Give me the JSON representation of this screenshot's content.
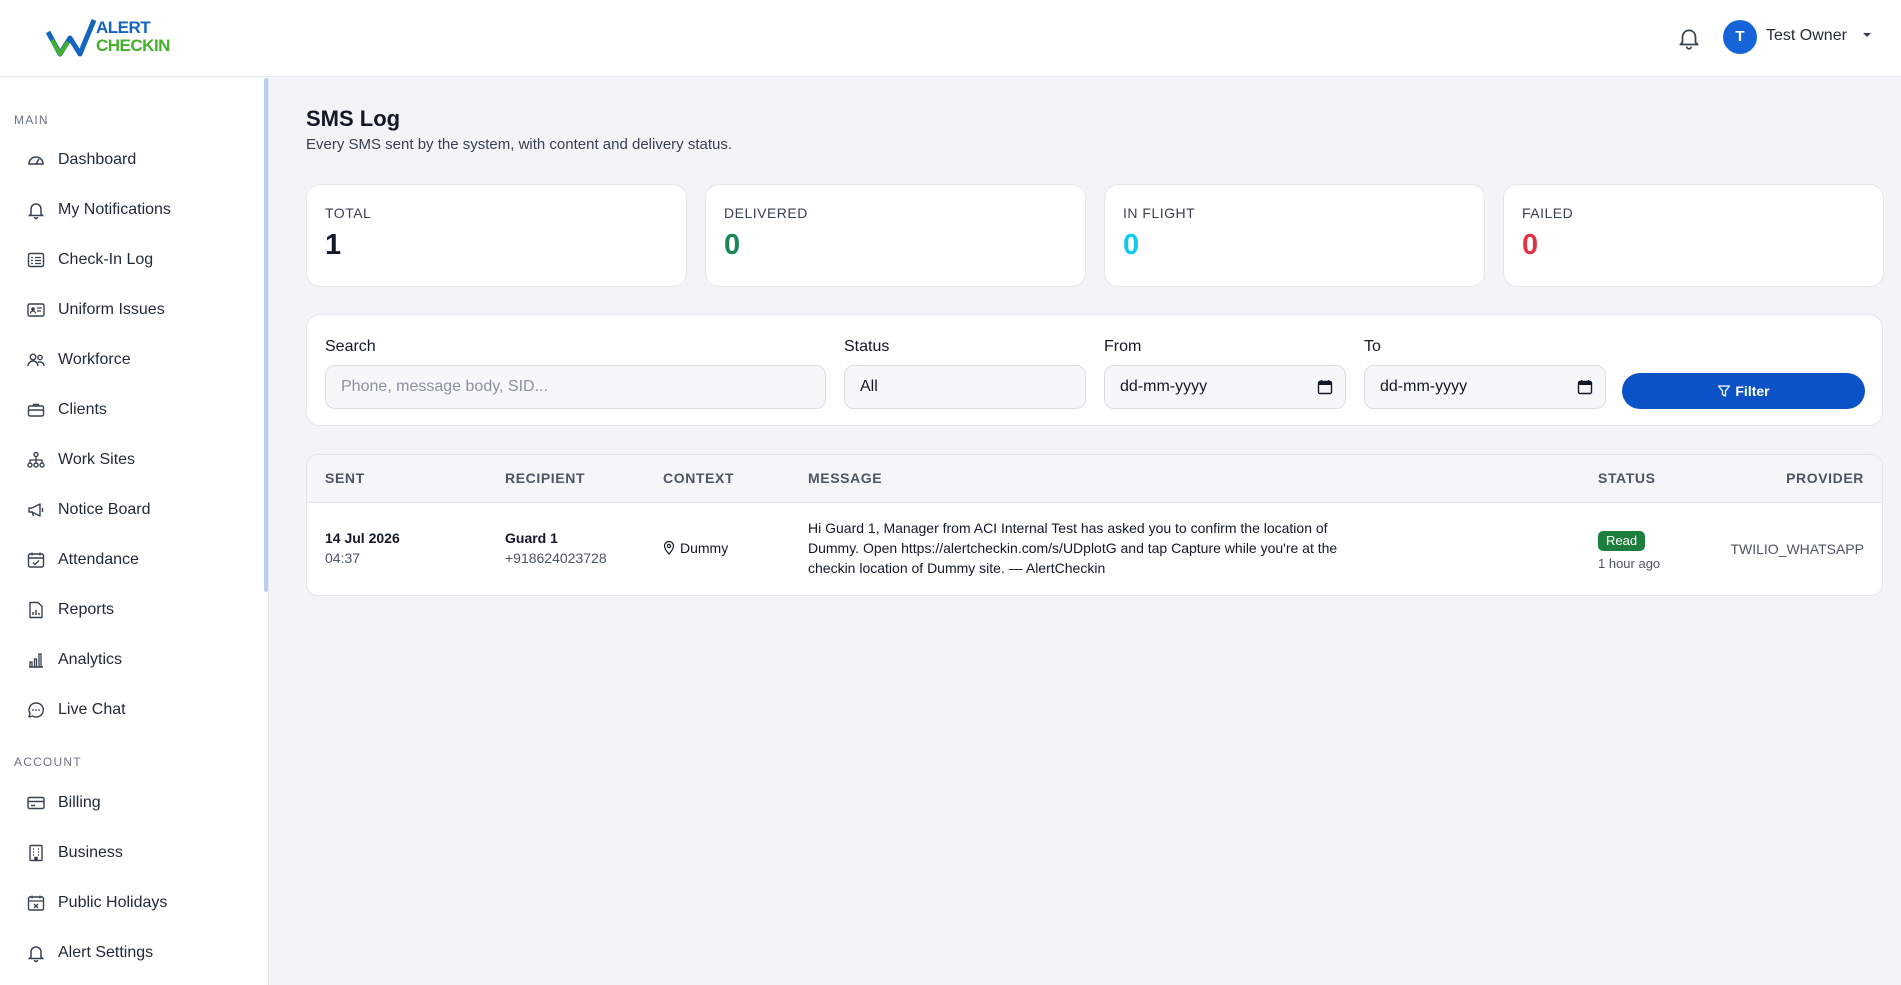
{
  "app": {
    "logo_line1": "ALERT",
    "logo_line2": "CHECKIN",
    "user_initial": "T",
    "user_name": "Test Owner"
  },
  "sidebar": {
    "main_label": "MAIN",
    "main_items": [
      {
        "label": "Dashboard",
        "icon": "dashboard-icon"
      },
      {
        "label": "My Notifications",
        "icon": "bell-icon"
      },
      {
        "label": "Check-In Log",
        "icon": "list-icon"
      },
      {
        "label": "Uniform Issues",
        "icon": "id-card-icon"
      },
      {
        "label": "Workforce",
        "icon": "people-icon"
      },
      {
        "label": "Clients",
        "icon": "briefcase-icon"
      },
      {
        "label": "Work Sites",
        "icon": "sitemap-icon"
      },
      {
        "label": "Notice Board",
        "icon": "megaphone-icon"
      },
      {
        "label": "Attendance",
        "icon": "calendar-check-icon"
      },
      {
        "label": "Reports",
        "icon": "report-icon"
      },
      {
        "label": "Analytics",
        "icon": "bar-chart-icon"
      },
      {
        "label": "Live Chat",
        "icon": "chat-icon"
      }
    ],
    "account_label": "ACCOUNT",
    "account_items": [
      {
        "label": "Billing",
        "icon": "credit-card-icon"
      },
      {
        "label": "Business",
        "icon": "building-icon"
      },
      {
        "label": "Public Holidays",
        "icon": "calendar-x-icon"
      },
      {
        "label": "Alert Settings",
        "icon": "bell-icon"
      }
    ]
  },
  "page": {
    "title": "SMS Log",
    "subtitle": "Every SMS sent by the system, with content and delivery status."
  },
  "stats": [
    {
      "label": "TOTAL",
      "value": "1",
      "color": "#111827"
    },
    {
      "label": "DELIVERED",
      "value": "0",
      "color": "#198754"
    },
    {
      "label": "IN FLIGHT",
      "value": "0",
      "color": "#0dcaf0"
    },
    {
      "label": "FAILED",
      "value": "0",
      "color": "#dc3545"
    }
  ],
  "filters": {
    "search_label": "Search",
    "search_placeholder": "Phone, message body, SID...",
    "status_label": "Status",
    "status_value": "All",
    "from_label": "From",
    "from_value": "dd-mm-yyyy",
    "to_label": "To",
    "to_value": "dd-mm-yyyy",
    "filter_button": "Filter"
  },
  "table": {
    "columns": [
      "SENT",
      "RECIPIENT",
      "CONTEXT",
      "MESSAGE",
      "STATUS",
      "PROVIDER"
    ],
    "rows": [
      {
        "sent_date": "14 Jul 2026",
        "sent_time": "04:37",
        "recipient_name": "Guard 1",
        "recipient_phone": "+918624023728",
        "context": "Dummy",
        "message_line1": "Hi Guard 1, Manager from ACI Internal Test has asked you to confirm the location of",
        "message_line2": "Dummy. Open https://alertcheckin.com/s/UDplotG and tap Capture while you're at the",
        "message_line3": "checkin location of Dummy site. — AlertCheckin",
        "status": "Read",
        "status_time": "1 hour ago",
        "provider": "TWILIO_WHATSAPP"
      }
    ]
  }
}
